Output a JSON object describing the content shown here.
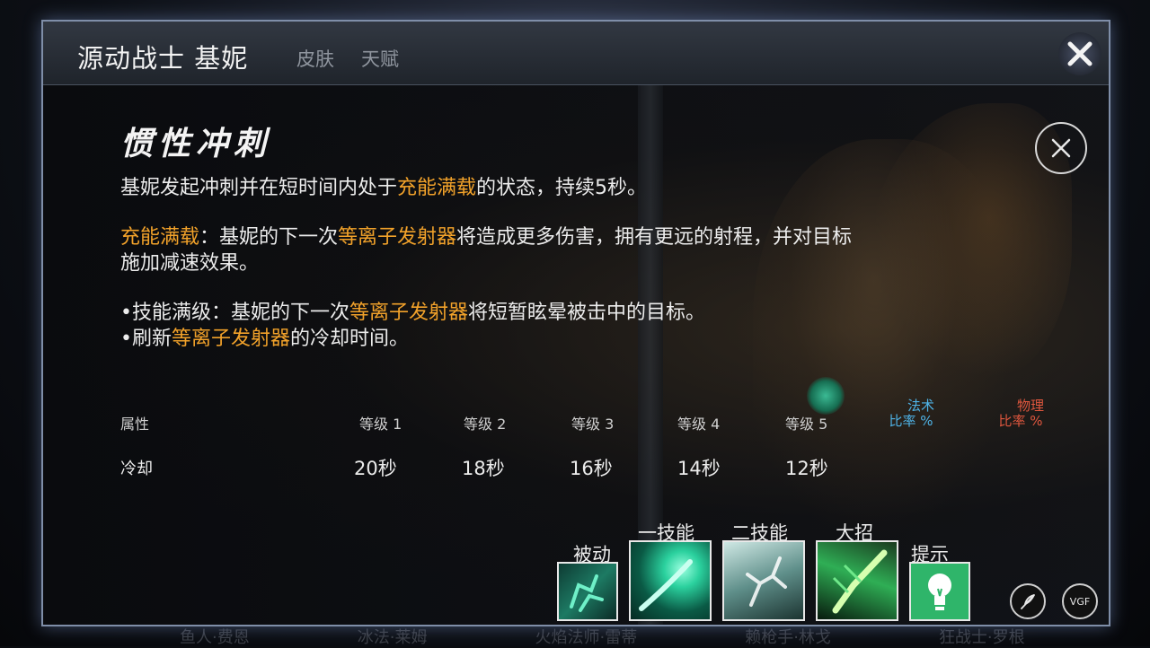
{
  "header": {
    "hero_title": "源动战士 基妮",
    "tabs": [
      "皮肤",
      "天赋"
    ]
  },
  "skill": {
    "name": "惯性冲刺",
    "line1": {
      "pre": "基妮发起冲刺并在短时间内处于",
      "hl": "充能满载",
      "post": "的状态，持续5秒。"
    },
    "para2": {
      "hl1": "充能满载",
      "mid1": "：基妮的下一次",
      "hl2": "等离子发射器",
      "post1": "将造成更多伤害，拥有更远的射程，并对目标",
      "line2": "施加减速效果。"
    },
    "bullet1": {
      "pre": "•技能满级：基妮的下一次",
      "hl": "等离子发射器",
      "post": "将短暂眩晕被击中的目标。"
    },
    "bullet2": {
      "pre": "•刷新",
      "hl": "等离子发射器",
      "post": "的冷却时间。"
    }
  },
  "stats": {
    "attr_label": "属性",
    "levels": [
      "等级 1",
      "等级 2",
      "等级 3",
      "等级 4",
      "等级 5"
    ],
    "magic_ratio": [
      "法术",
      "比率 %"
    ],
    "phys_ratio": [
      "物理",
      "比率 %"
    ],
    "row_label": "冷却",
    "values": [
      "20秒",
      "18秒",
      "16秒",
      "14秒",
      "12秒"
    ]
  },
  "abilities": {
    "passive": "被动",
    "skill1": "一技能",
    "skill2": "二技能",
    "ultimate": "大招",
    "tips": "提示"
  },
  "buttons": {
    "vgf_label": "VGF"
  },
  "bottom_tabs": [
    "鱼人·费恩",
    "冰法·莱姆",
    "火焰法师·雷蒂",
    "赖枪手·林戈",
    "狂战士·罗根"
  ],
  "colors": {
    "highlight": "#f2a22a",
    "magic": "#4fb4e8",
    "physical": "#e0573e",
    "panel_border": "#7f8ea8"
  },
  "icons": [
    "close-icon",
    "close-circle-icon",
    "feather-icon",
    "vgf-icon",
    "lightbulb-icon"
  ]
}
